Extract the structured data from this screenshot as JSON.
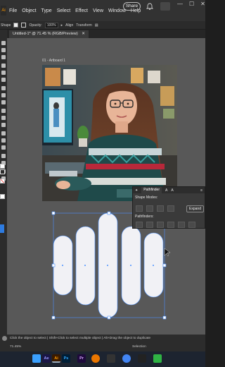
{
  "menubar": {
    "app_logo": "Ai",
    "items": [
      "File",
      "Object",
      "Type",
      "Select",
      "Effect",
      "View",
      "Window",
      "Help"
    ],
    "share_label": "Share",
    "window_controls": [
      "—",
      "☐",
      "✕"
    ]
  },
  "control_bar": {
    "shape_label": "Shape",
    "opacity_label": "Opacity:",
    "opacity_value": "100%",
    "align_label": "Align",
    "transform_label": "Transform"
  },
  "document_tab": {
    "title": "Untitled-1* @ 71.45 % (RGB/Preview)",
    "close_glyph": "✕"
  },
  "artboard": {
    "label": "01 - Artboard 1"
  },
  "pathfinder": {
    "tab_label": "Pathfinder",
    "other_tabs": [
      "✦",
      "A",
      "A"
    ],
    "shape_modes_label": "Shape Modes:",
    "pathfinders_label": "Pathfinders:",
    "expand_label": "Expand"
  },
  "status_bar": {
    "message": "Click the object to select  |  Shift+Click to select multiple object  |  Alt+Drag the object to duplicate",
    "zoom_value": "71.45%",
    "mode_label": "Selection"
  },
  "taskbar": {
    "apps": [
      {
        "name": "windows",
        "label": "",
        "color": "#3aa0ff"
      },
      {
        "name": "after-effects",
        "label": "Ae",
        "color": "#1a1646"
      },
      {
        "name": "illustrator",
        "label": "Ai",
        "color": "#3a1a00"
      },
      {
        "name": "photoshop",
        "label": "Ps",
        "color": "#001e36"
      },
      {
        "name": "premiere",
        "label": "Pr",
        "color": "#1e0a3c"
      },
      {
        "name": "blender",
        "label": "",
        "color": "#ea7600"
      },
      {
        "name": "davinci",
        "label": "",
        "color": "#333"
      },
      {
        "name": "chrome",
        "label": "",
        "color": "#4285f4"
      },
      {
        "name": "figma",
        "label": "",
        "color": "#222"
      },
      {
        "name": "green-app",
        "label": "",
        "color": "#2fb344"
      }
    ]
  },
  "colors": {
    "selection_blue": "#4a90ff",
    "shape_fill": "#f1f1f5"
  }
}
